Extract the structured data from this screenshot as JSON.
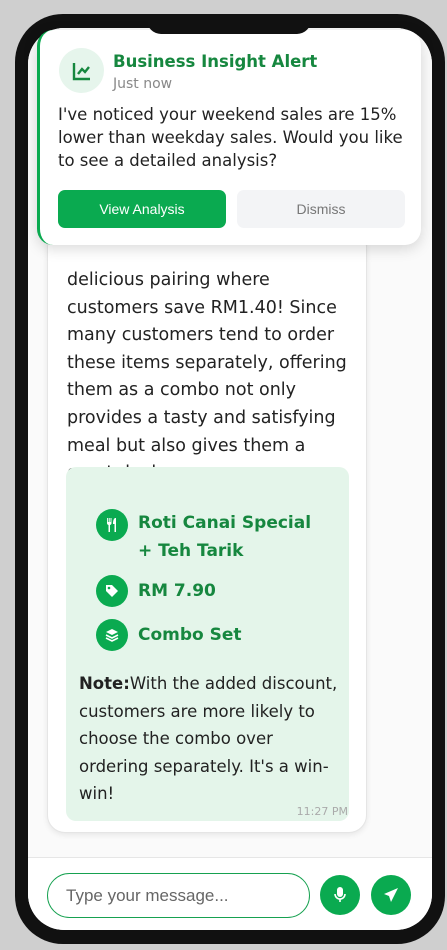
{
  "notification": {
    "title": "Business Insight Alert",
    "time": "Just now",
    "message": "I've noticed your weekend sales are 15% lower than weekday sales. Would you like to see a detailed analysis?",
    "primary_label": "View Analysis",
    "secondary_label": "Dismiss"
  },
  "message": {
    "text": "delicious pairing where customers save RM1.40! Since many customers tend to order these items separately, offering them as a combo not only provides a tasty and satisfying meal but also gives them a great deal",
    "product": "Roti Canai Special + Teh Tarik",
    "price": "RM 7.90",
    "type": "Combo Set",
    "note_label": "Note:",
    "note_text": "With the added discount, customers are more likely to choose the combo over ordering separately. It's a win-win!",
    "time": "11:27 PM"
  },
  "composer": {
    "placeholder": "Type your message..."
  },
  "colors": {
    "accent": "#0aaa50",
    "accent_text": "#16873f",
    "card_bg": "#e4f5ea"
  }
}
